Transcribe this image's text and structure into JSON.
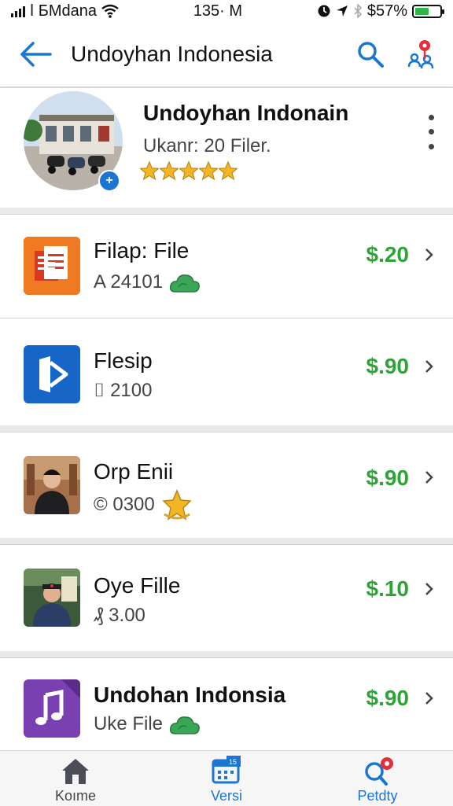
{
  "status_bar": {
    "carrier": "ǀ БMdana",
    "time": "135· M",
    "battery": "$57%",
    "battery_level": 0.57
  },
  "header": {
    "title": "Undoyhan Indonesia",
    "back_icon": "arrow-left-icon",
    "search_icon": "search-icon",
    "location_icon": "map-pin-people-icon"
  },
  "profile": {
    "name": "Undoyhan Indonain",
    "subtitle": "Ukanr: 20 Filer.",
    "rating": 5,
    "more_icon": "more-vertical-icon"
  },
  "items": [
    {
      "title": "Filap: File",
      "meta": "A 24101",
      "price": "$.20"
    },
    {
      "title": "Flesip",
      "meta": "⌷ 2100",
      "price": "$.90"
    },
    {
      "title": "Orp Enii",
      "meta": "© 0300",
      "price": "$.90"
    },
    {
      "title": "Oye Fille",
      "meta": "₰ 3.00",
      "price": "$.10"
    },
    {
      "title": "Undohan Indonsia",
      "meta": "Uke File",
      "price": "$.90"
    }
  ],
  "tabs": [
    {
      "label": "Koıme",
      "icon": "home-icon"
    },
    {
      "label": "Versi",
      "icon": "calendar-icon"
    },
    {
      "label": "Petdty",
      "icon": "search-notification-icon"
    }
  ],
  "colors": {
    "accent": "#1b76d2",
    "price": "#2ea336",
    "badge_red": "#e3313a",
    "star_gold": "#f2b625"
  }
}
